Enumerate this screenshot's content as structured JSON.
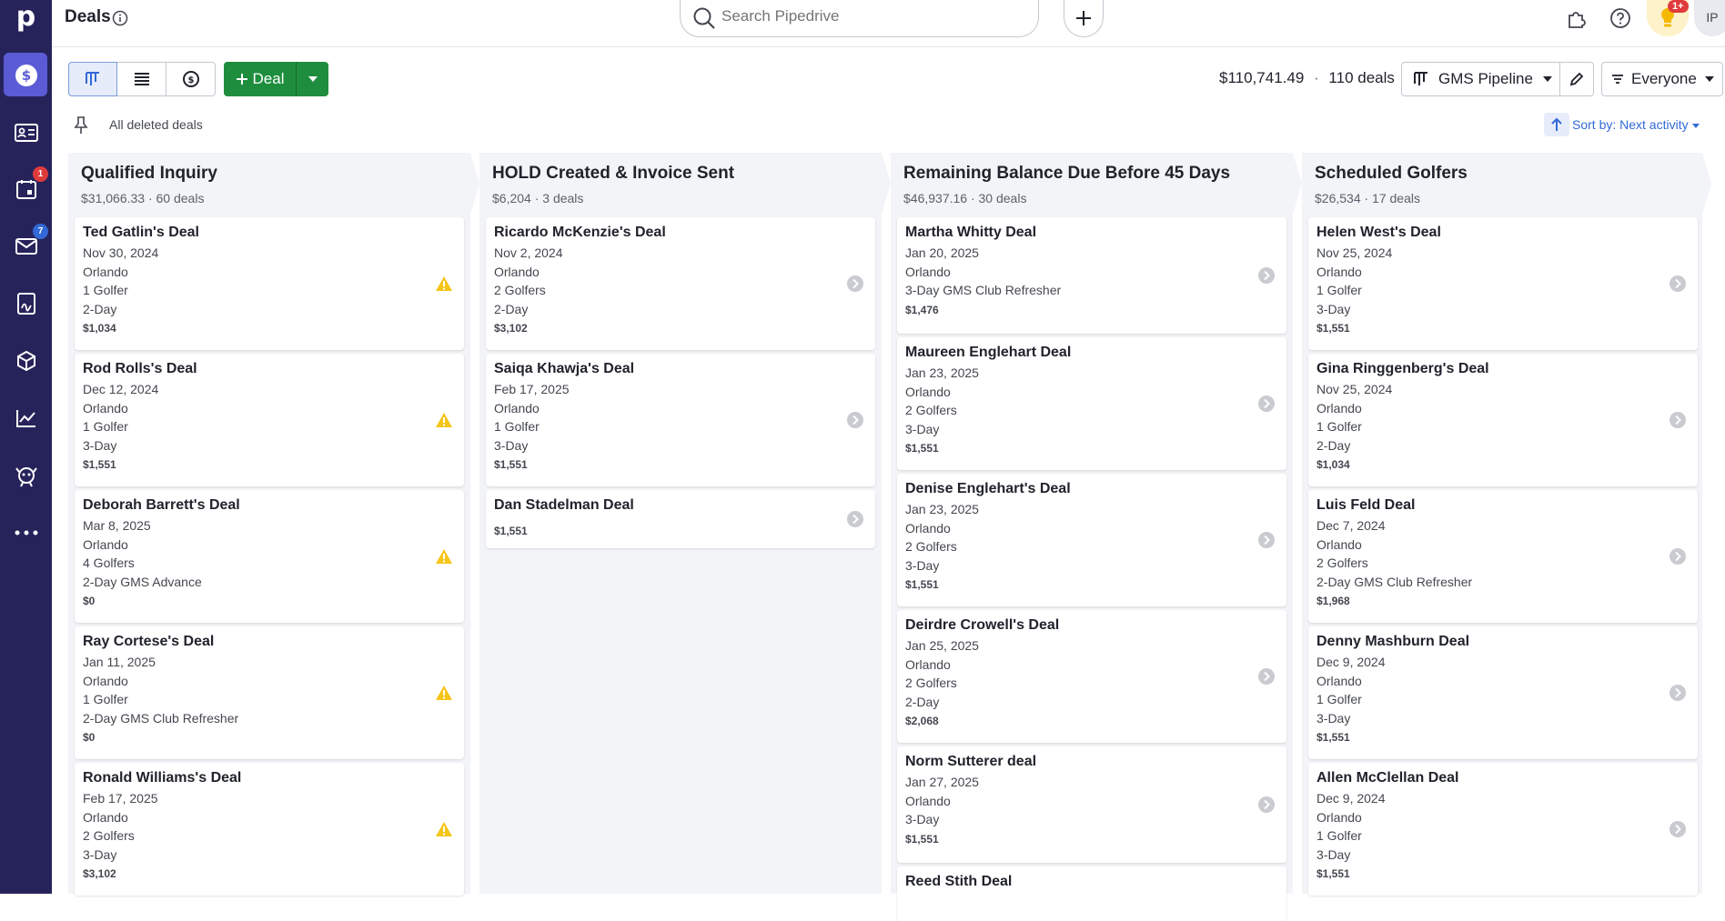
{
  "app": {
    "logo": "p"
  },
  "sidebar": {
    "items": [
      {
        "name": "deals",
        "badge": ""
      },
      {
        "name": "leads",
        "badge": ""
      },
      {
        "name": "activities",
        "badge": "1"
      },
      {
        "name": "mail",
        "badge": "7"
      },
      {
        "name": "documents",
        "badge": ""
      },
      {
        "name": "products",
        "badge": ""
      },
      {
        "name": "insights",
        "badge": ""
      },
      {
        "name": "marketplace",
        "badge": ""
      },
      {
        "name": "more",
        "badge": ""
      }
    ]
  },
  "header": {
    "title": "Deals",
    "search_placeholder": "Search Pipedrive",
    "tips_badge": "1+",
    "avatar": "IP"
  },
  "toolbar": {
    "deal_label": "Deal",
    "total_value": "$110,741.49",
    "separator": "·",
    "deal_count": "110 deals",
    "pipeline": "GMS Pipeline",
    "owner_filter": "Everyone"
  },
  "subbar": {
    "deleted_link": "All deleted deals",
    "sort_label": "Sort by: Next activity"
  },
  "colors": {
    "accent": "#5b5bd6",
    "primary_button": "#1e8e3e",
    "warning": "#f5c518",
    "link": "#3269d6"
  },
  "stages": [
    {
      "title": "Qualified Inquiry",
      "summary": "$31,066.33 · 60 deals",
      "status_icon": "warning-icon",
      "cards": [
        {
          "title": "Ted Gatlin's Deal",
          "lines": [
            "Nov 30, 2024",
            "Orlando",
            "1 Golfer",
            "2-Day"
          ],
          "value": "$1,034"
        },
        {
          "title": "Rod Rolls's Deal",
          "lines": [
            "Dec 12, 2024",
            "Orlando",
            "1 Golfer",
            "3-Day"
          ],
          "value": "$1,551"
        },
        {
          "title": "Deborah Barrett's Deal",
          "lines": [
            "Mar 8, 2025",
            "Orlando",
            "4 Golfers",
            "2-Day GMS Advance"
          ],
          "value": "$0"
        },
        {
          "title": "Ray Cortese's Deal",
          "lines": [
            "Jan 11, 2025",
            "Orlando",
            "1 Golfer",
            "2-Day GMS Club Refresher"
          ],
          "value": "$0"
        },
        {
          "title": "Ronald Williams's Deal",
          "lines": [
            "Feb 17, 2025",
            "Orlando",
            "2 Golfers",
            "3-Day"
          ],
          "value": "$3,102"
        }
      ]
    },
    {
      "title": "HOLD Created & Invoice Sent",
      "summary": "$6,204 · 3 deals",
      "status_icon": "chevron-right-icon",
      "cards": [
        {
          "title": "Ricardo McKenzie's Deal",
          "lines": [
            "Nov 2, 2024",
            "Orlando",
            "2 Golfers",
            "2-Day"
          ],
          "value": "$3,102"
        },
        {
          "title": "Saiqa Khawja's Deal",
          "lines": [
            "Feb 17, 2025",
            "Orlando",
            "1 Golfer",
            "3-Day"
          ],
          "value": "$1,551"
        },
        {
          "title": "Dan Stadelman Deal",
          "lines": [],
          "value": "$1,551"
        }
      ]
    },
    {
      "title": "Remaining Balance Due Before 45 Days",
      "summary": "$46,937.16 · 30 deals",
      "status_icon": "chevron-right-icon",
      "cards": [
        {
          "title": "Martha Whitty Deal",
          "lines": [
            "Jan 20, 2025",
            "Orlando",
            "3-Day GMS Club Refresher"
          ],
          "value": "$1,476"
        },
        {
          "title": "Maureen Englehart Deal",
          "lines": [
            "Jan 23, 2025",
            "Orlando",
            "2 Golfers",
            "3-Day"
          ],
          "value": "$1,551"
        },
        {
          "title": "Denise Englehart's Deal",
          "lines": [
            "Jan 23, 2025",
            "Orlando",
            "2 Golfers",
            "3-Day"
          ],
          "value": "$1,551"
        },
        {
          "title": "Deirdre Crowell's Deal",
          "lines": [
            "Jan 25, 2025",
            "Orlando",
            "2 Golfers",
            "2-Day"
          ],
          "value": "$2,068"
        },
        {
          "title": "Norm Sutterer deal",
          "lines": [
            "Jan 27, 2025",
            "Orlando",
            "3-Day"
          ],
          "value": "$1,551"
        },
        {
          "title": "Reed Stith Deal",
          "lines": [],
          "value": ""
        }
      ]
    },
    {
      "title": "Scheduled Golfers",
      "summary": "$26,534 · 17 deals",
      "status_icon": "chevron-right-icon",
      "cards": [
        {
          "title": "Helen West's Deal",
          "lines": [
            "Nov 25, 2024",
            "Orlando",
            "1 Golfer",
            "3-Day"
          ],
          "value": "$1,551"
        },
        {
          "title": "Gina Ringgenberg's Deal",
          "lines": [
            "Nov 25, 2024",
            "Orlando",
            "1 Golfer",
            "2-Day"
          ],
          "value": "$1,034"
        },
        {
          "title": "Luis Feld Deal",
          "lines": [
            "Dec 7, 2024",
            "Orlando",
            "2 Golfers",
            "2-Day GMS Club Refresher"
          ],
          "value": "$1,968"
        },
        {
          "title": "Denny Mashburn Deal",
          "lines": [
            "Dec 9, 2024",
            "Orlando",
            "1 Golfer",
            "3-Day"
          ],
          "value": "$1,551"
        },
        {
          "title": "Allen McClellan Deal",
          "lines": [
            "Dec 9, 2024",
            "Orlando",
            "1 Golfer",
            "3-Day"
          ],
          "value": "$1,551"
        }
      ]
    }
  ]
}
